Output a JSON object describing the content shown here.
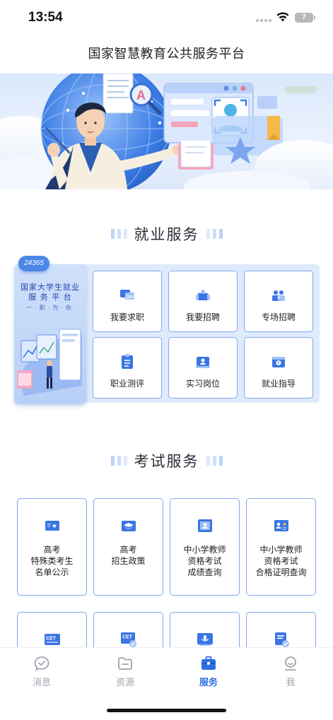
{
  "status_bar": {
    "time": "13:54",
    "battery": "7"
  },
  "header": {
    "title": "国家智慧教育公共服务平台"
  },
  "banner": {
    "search_letter": "A"
  },
  "employment": {
    "heading": "就业服务",
    "card": {
      "badge": "24365",
      "title_line1": "国家大学生就业",
      "title_line2": "服 务 平 台",
      "slogan": "一·职·为·你"
    },
    "items": [
      {
        "label": "我要求职",
        "icon": "job-seek-icon"
      },
      {
        "label": "我要招聘",
        "icon": "recruit-icon"
      },
      {
        "label": "专场招聘",
        "icon": "special-recruit-icon"
      },
      {
        "label": "职业测评",
        "icon": "career-assessment-icon"
      },
      {
        "label": "实习岗位",
        "icon": "internship-icon"
      },
      {
        "label": "就业指导",
        "icon": "career-guidance-icon"
      }
    ]
  },
  "exam": {
    "heading": "考试服务",
    "items": [
      {
        "label": "高考\n特殊类考生\n名单公示",
        "icon": "special-candidates-icon"
      },
      {
        "label": "高考\n招生政策",
        "icon": "admission-policy-icon"
      },
      {
        "label": "中小学教师\n资格考试\n成绩查询",
        "icon": "teacher-score-icon"
      },
      {
        "label": "中小学教师\n资格考试\n合格证明查询",
        "icon": "teacher-certificate-icon"
      }
    ],
    "partial_items": [
      {
        "badge": "CET",
        "icon": "cet-icon"
      },
      {
        "badge": "CET",
        "icon": "cet-verify-icon"
      },
      {
        "badge": "",
        "icon": "mic-icon"
      },
      {
        "badge": "",
        "icon": "mandarin-verify-icon"
      }
    ]
  },
  "bottom_nav": {
    "items": [
      {
        "label": "消息",
        "icon": "message-icon",
        "active": false
      },
      {
        "label": "资源",
        "icon": "folder-icon",
        "active": false
      },
      {
        "label": "服务",
        "icon": "briefcase-icon",
        "active": true
      },
      {
        "label": "我",
        "icon": "profile-icon",
        "active": false
      }
    ]
  },
  "colors": {
    "accent": "#2d6fe0",
    "tile_border": "#7fa9ee",
    "inactive_nav": "#9ca3ad"
  }
}
